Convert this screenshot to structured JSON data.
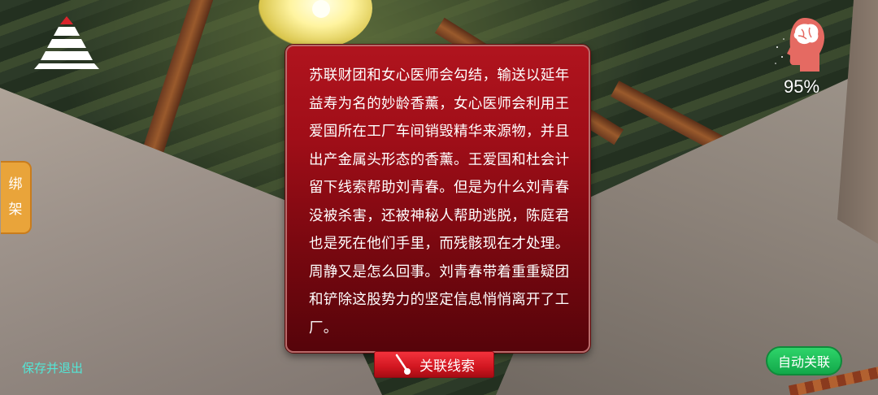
{
  "hud": {
    "menu_icon": "pyramid-menu-icon",
    "sanity_icon": "brain-head-icon",
    "sanity_percent": "95%"
  },
  "side_tab": {
    "chars": [
      "绑",
      "架"
    ]
  },
  "clue_panel": {
    "text": "苏联财团和女心医师会勾结，输送以延年益寿为名的妙龄香薰，女心医师会利用王爱国所在工厂车间销毁精华来源物，并且出产金属头形态的香薰。王爱国和杜会计留下线索帮助刘青春。但是为什么刘青春没被杀害，还被神秘人帮助逃脱，陈庭君也是死在他们手里，而残骸现在才处理。周静又是怎么回事。刘青春带着重重疑团和铲除这股势力的坚定信息悄悄离开了工厂。"
  },
  "buttons": {
    "related_clues": "关联线索",
    "save_exit": "保存并退出",
    "auto_link": "自动关联"
  },
  "colors": {
    "panel_red": "#a00e18",
    "button_red": "#d11620",
    "auto_green": "#12a84a",
    "tab_orange": "#e9a43a",
    "save_cyan": "#53e6d6"
  }
}
